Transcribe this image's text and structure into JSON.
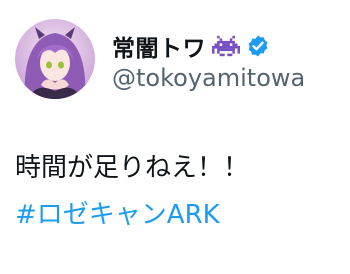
{
  "author": {
    "display_name": "常闇トワ",
    "name_emoji": "space-invader-icon",
    "verified_badge": "verified-badge-icon",
    "handle": "@tokoyamitowa"
  },
  "tweet": {
    "text": "時間が足りねえ！！",
    "hashtag": "#ロゼキャンARK"
  },
  "colors": {
    "hashtag": "#1d9bf0",
    "handle": "#536471",
    "verified": "#1d9bf0",
    "emoji": "#7a4fc4"
  }
}
